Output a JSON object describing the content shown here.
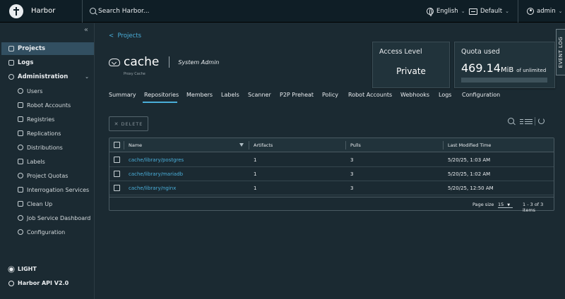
{
  "header": {
    "brand": "Harbor",
    "search_placeholder": "Search Harbor...",
    "language": "English",
    "theme": "Default",
    "user": "admin"
  },
  "sidebar": {
    "items": [
      {
        "label": "Projects",
        "icon": "projects-icon",
        "active": true
      },
      {
        "label": "Logs",
        "icon": "logs-icon"
      },
      {
        "label": "Administration",
        "icon": "administration-icon"
      },
      {
        "label": "Users",
        "icon": "users-icon"
      },
      {
        "label": "Robot Accounts",
        "icon": "robot-icon"
      },
      {
        "label": "Registries",
        "icon": "registries-icon"
      },
      {
        "label": "Replications",
        "icon": "replications-icon"
      },
      {
        "label": "Distributions",
        "icon": "distributions-icon"
      },
      {
        "label": "Labels",
        "icon": "labels-icon"
      },
      {
        "label": "Project Quotas",
        "icon": "quotas-icon"
      },
      {
        "label": "Interrogation Services",
        "icon": "shield-icon"
      },
      {
        "label": "Clean Up",
        "icon": "clean-up-icon"
      },
      {
        "label": "Job Service Dashboard",
        "icon": "dashboard-icon"
      },
      {
        "label": "Configuration",
        "icon": "gear-icon"
      }
    ],
    "theme_toggle": "LIGHT",
    "api_link": "Harbor API V2.0"
  },
  "project": {
    "back_label": "Projects",
    "name": "cache",
    "role": "System Admin",
    "subtitle": "Proxy Cache",
    "access_level_title": "Access Level",
    "access_level_value": "Private",
    "quota_title": "Quota used",
    "quota_number": "469.14",
    "quota_unit": "MiB",
    "quota_limit": "of unlimited",
    "quota_fill_fraction": 0,
    "event_log": "EVENT LOG"
  },
  "tabs": [
    "Summary",
    "Repositories",
    "Members",
    "Labels",
    "Scanner",
    "P2P Preheat",
    "Policy",
    "Robot Accounts",
    "Webhooks",
    "Logs",
    "Configuration"
  ],
  "active_tab": "Repositories",
  "toolbar": {
    "delete_label": "DELETE"
  },
  "table": {
    "headers": [
      "Name",
      "Artifacts",
      "Pulls",
      "Last Modified Time"
    ],
    "rows": [
      {
        "name": "cache/library/postgres",
        "artifacts": "1",
        "pulls": "3",
        "modified": "5/20/25, 1:03 AM"
      },
      {
        "name": "cache/library/mariadb",
        "artifacts": "1",
        "pulls": "3",
        "modified": "5/20/25, 1:02 AM"
      },
      {
        "name": "cache/library/nginx",
        "artifacts": "1",
        "pulls": "3",
        "modified": "5/20/25, 12:50 AM"
      }
    ],
    "page_size_label": "Page size",
    "page_size": "15",
    "range": "1 - 3 of 3 items"
  },
  "colors": {
    "accent": "#4aaed9",
    "background": "#1b2a32",
    "header": "#0f1e26",
    "active_nav": "#324f61"
  }
}
